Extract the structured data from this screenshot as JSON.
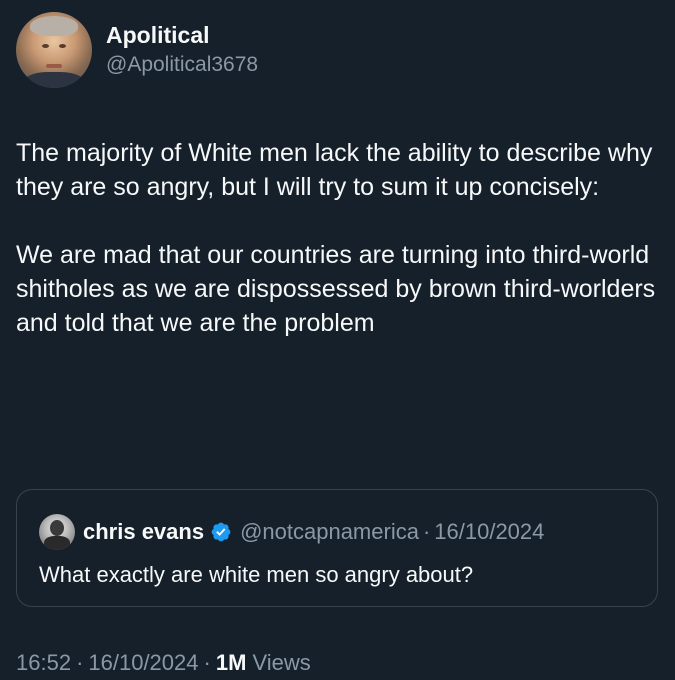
{
  "author": {
    "display_name": "Apolitical",
    "handle": "@Apolitical3678",
    "avatar_icon": "portrait-avatar"
  },
  "post": {
    "paragraphs": [
      "The majority of White men lack the ability to describe why they are so angry, but I will try to sum it up concisely:",
      "We are mad that our countries are turning into third-world shitholes as we are dispossessed by brown third-worlders and told that we are the problem"
    ]
  },
  "quoted_post": {
    "display_name": "chris evans",
    "verified_icon": "verified-badge-icon",
    "handle": "@notcapnamerica",
    "separator": "·",
    "date": "16/10/2024",
    "text": "What exactly are white men so angry about?"
  },
  "meta": {
    "time": "16:52",
    "separator": "·",
    "date": "16/10/2024",
    "views_count": "1M",
    "views_label": "Views"
  },
  "colors": {
    "background": "#15202b",
    "text": "#f7f9f9",
    "muted": "#8b98a5",
    "border": "#38444d",
    "verified": "#1d9bf0"
  }
}
